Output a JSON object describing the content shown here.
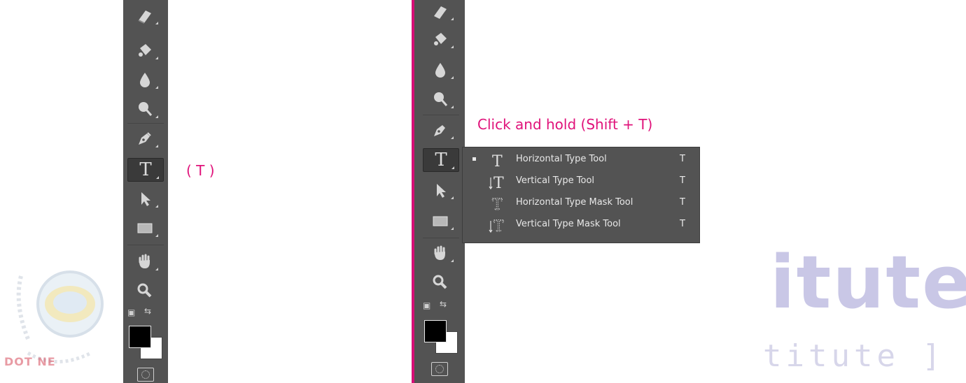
{
  "annotations": {
    "shortcut": "( T )",
    "click_hold": "Click and hold (Shift + T)"
  },
  "flyout": {
    "items": [
      {
        "label": "Horizontal Type Tool",
        "shortcut": "T",
        "icon": "type-horizontal-icon",
        "selected": true
      },
      {
        "label": "Vertical Type Tool",
        "shortcut": "T",
        "icon": "type-vertical-icon",
        "selected": false
      },
      {
        "label": "Horizontal Type Mask Tool",
        "shortcut": "T",
        "icon": "type-horizontal-mask-icon",
        "selected": false
      },
      {
        "label": "Vertical Type Mask Tool",
        "shortcut": "T",
        "icon": "type-vertical-mask-icon",
        "selected": false
      }
    ]
  },
  "toolbar": {
    "tools": [
      "eraser-icon",
      "paint-bucket-icon",
      "blur-drop-icon",
      "dodge-icon",
      "pen-icon",
      "type-tool-icon",
      "path-selection-icon",
      "rectangle-icon",
      "hand-icon",
      "zoom-icon"
    ],
    "type_letter": "T"
  },
  "watermark": {
    "big": "itute",
    "small": "titute ]",
    "logo_text": "DOT NE"
  },
  "colors": {
    "toolbar_bg": "#535353",
    "accent_pink": "#e0127a",
    "foreground_swatch": "#000000",
    "background_swatch": "#ffffff"
  }
}
